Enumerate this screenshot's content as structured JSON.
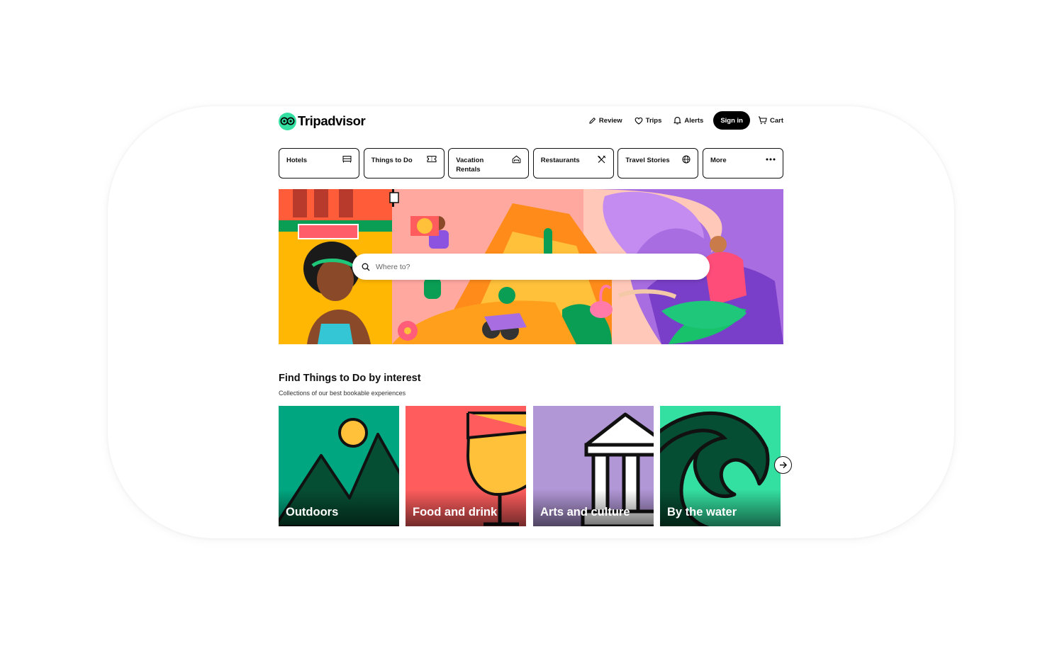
{
  "header": {
    "brand": "Tripadvisor",
    "nav": [
      {
        "label": "Review",
        "icon": "pencil-icon"
      },
      {
        "label": "Trips",
        "icon": "heart-icon"
      },
      {
        "label": "Alerts",
        "icon": "bell-icon"
      }
    ],
    "signin_label": "Sign in",
    "cart_label": "Cart"
  },
  "tabs": [
    {
      "label": "Hotels",
      "icon": "bed-icon"
    },
    {
      "label": "Things to Do",
      "icon": "ticket-icon"
    },
    {
      "label": "Vacation Rentals",
      "icon": "house-icon"
    },
    {
      "label": "Restaurants",
      "icon": "fork-knife-icon"
    },
    {
      "label": "Travel Stories",
      "icon": "globe-icon"
    },
    {
      "label": "More",
      "icon": "more-dots-icon"
    }
  ],
  "search": {
    "placeholder": "Where to?"
  },
  "section": {
    "title": "Find Things to Do by interest",
    "subtitle": "Collections of our best bookable experiences",
    "cards": [
      {
        "label": "Outdoors",
        "color": "#00a680"
      },
      {
        "label": "Food and drink",
        "color": "#ff5d5d"
      },
      {
        "label": "Arts and culture",
        "color": "#b197d6"
      },
      {
        "label": "By the water",
        "color": "#34e0a1"
      }
    ]
  },
  "colors": {
    "brand": "#34e0a1",
    "text": "#111111"
  }
}
